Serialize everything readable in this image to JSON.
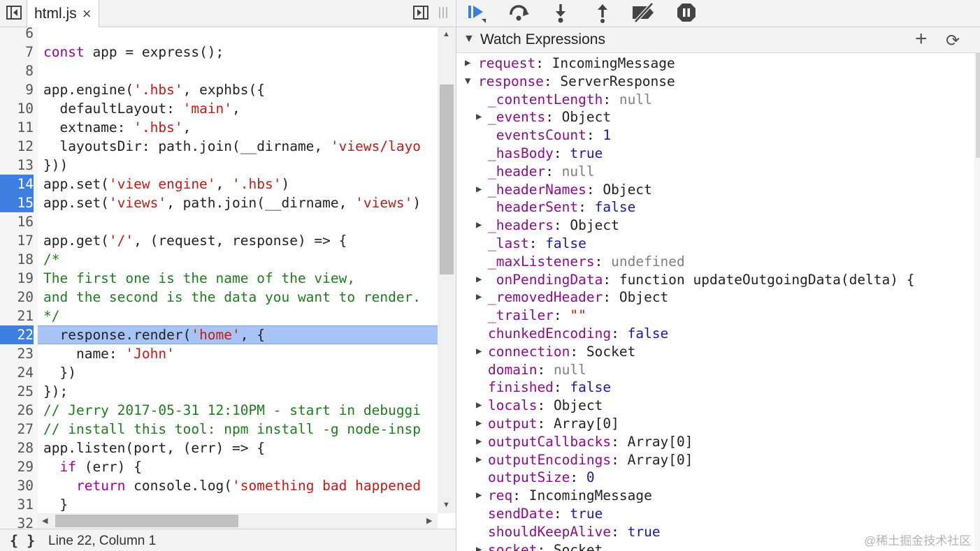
{
  "editor": {
    "tab_label": "html.js",
    "tab_close": "×",
    "lines": [
      {
        "n": "6",
        "parts": []
      },
      {
        "n": "7",
        "parts": [
          [
            "kw",
            "const"
          ],
          [
            "p",
            " app = express();"
          ]
        ]
      },
      {
        "n": "8",
        "parts": []
      },
      {
        "n": "9",
        "parts": [
          [
            "p",
            "app.engine("
          ],
          [
            "str",
            "'.hbs'"
          ],
          [
            "p",
            ", exphbs({"
          ]
        ]
      },
      {
        "n": "10",
        "parts": [
          [
            "p",
            "  defaultLayout: "
          ],
          [
            "str",
            "'main'"
          ],
          [
            "p",
            ","
          ]
        ]
      },
      {
        "n": "11",
        "parts": [
          [
            "p",
            "  extname: "
          ],
          [
            "str",
            "'.hbs'"
          ],
          [
            "p",
            ","
          ]
        ]
      },
      {
        "n": "12",
        "parts": [
          [
            "p",
            "  layoutsDir: path.join(__dirname, "
          ],
          [
            "str",
            "'views/layo"
          ]
        ]
      },
      {
        "n": "13",
        "parts": [
          [
            "p",
            "}))"
          ]
        ]
      },
      {
        "n": "14",
        "bp": true,
        "parts": [
          [
            "p",
            "app.set("
          ],
          [
            "str",
            "'view engine'"
          ],
          [
            "p",
            ", "
          ],
          [
            "str",
            "'.hbs'"
          ],
          [
            "p",
            ")"
          ]
        ]
      },
      {
        "n": "15",
        "bp": true,
        "parts": [
          [
            "p",
            "app.set("
          ],
          [
            "str",
            "'views'"
          ],
          [
            "p",
            ", path.join(__dirname, "
          ],
          [
            "str",
            "'views'"
          ],
          [
            "p",
            ")"
          ]
        ]
      },
      {
        "n": "16",
        "parts": []
      },
      {
        "n": "17",
        "parts": [
          [
            "p",
            "app.get("
          ],
          [
            "str",
            "'/'"
          ],
          [
            "p",
            ", (request, response) => {"
          ]
        ]
      },
      {
        "n": "18",
        "parts": [
          [
            "cm",
            "/*"
          ]
        ]
      },
      {
        "n": "19",
        "parts": [
          [
            "cm",
            "The first one is the name of the view,"
          ]
        ]
      },
      {
        "n": "20",
        "parts": [
          [
            "cm",
            "and the second is the data you want to render."
          ]
        ]
      },
      {
        "n": "21",
        "parts": [
          [
            "cm",
            "*/"
          ]
        ]
      },
      {
        "n": "22",
        "bp": true,
        "exec": true,
        "parts": [
          [
            "p",
            "  response.render("
          ],
          [
            "str",
            "'home'"
          ],
          [
            "p",
            ", {"
          ]
        ]
      },
      {
        "n": "23",
        "parts": [
          [
            "p",
            "    name: "
          ],
          [
            "str",
            "'John'"
          ]
        ]
      },
      {
        "n": "24",
        "parts": [
          [
            "p",
            "  })"
          ]
        ]
      },
      {
        "n": "25",
        "parts": [
          [
            "p",
            "});"
          ]
        ]
      },
      {
        "n": "26",
        "parts": [
          [
            "cm",
            "// Jerry 2017-05-31 12:10PM - start in debuggi"
          ]
        ]
      },
      {
        "n": "27",
        "parts": [
          [
            "cm",
            "// install this tool: npm install -g node-insp"
          ]
        ]
      },
      {
        "n": "28",
        "parts": [
          [
            "p",
            "app.listen(port, (err) => {"
          ]
        ]
      },
      {
        "n": "29",
        "parts": [
          [
            "p",
            "  "
          ],
          [
            "kw",
            "if"
          ],
          [
            "p",
            " (err) {"
          ]
        ]
      },
      {
        "n": "30",
        "parts": [
          [
            "p",
            "    "
          ],
          [
            "kw",
            "return"
          ],
          [
            "p",
            " console.log("
          ],
          [
            "str",
            "'something bad happened"
          ]
        ]
      },
      {
        "n": "31",
        "parts": [
          [
            "p",
            "  }"
          ]
        ]
      },
      {
        "n": "32",
        "parts": []
      }
    ],
    "status_icon": "{ }",
    "status_position": "Line 22, Column 1"
  },
  "debugger": {
    "toolbar_icons": [
      "resume-icon",
      "step-over-icon",
      "step-into-icon",
      "step-out-icon",
      "deactivate-breakpoints-icon",
      "pause-on-exceptions-icon"
    ],
    "watch_title": "Watch Expressions",
    "add_glyph": "+",
    "refresh_glyph": "⟳",
    "props": [
      {
        "d": 0,
        "e": "c",
        "name": "request",
        "sep": ": ",
        "val": "IncomingMessage",
        "t": "obj"
      },
      {
        "d": 0,
        "e": "o",
        "name": "response",
        "sep": ": ",
        "val": "ServerResponse",
        "t": "obj"
      },
      {
        "d": 1,
        "e": "",
        "name": "_contentLength",
        "sep": ": ",
        "val": "null",
        "t": "null"
      },
      {
        "d": 1,
        "e": "c",
        "name": "_events",
        "sep": ": ",
        "val": "Object",
        "t": "obj"
      },
      {
        "d": 1,
        "e": "",
        "name": " eventsCount",
        "sep": ": ",
        "val": "1",
        "t": "num"
      },
      {
        "d": 1,
        "e": "",
        "name": "_hasBody",
        "sep": ": ",
        "val": "true",
        "t": "bool"
      },
      {
        "d": 1,
        "e": "",
        "name": "_header",
        "sep": ": ",
        "val": "null",
        "t": "null"
      },
      {
        "d": 1,
        "e": "c",
        "name": "_headerNames",
        "sep": ": ",
        "val": "Object",
        "t": "obj"
      },
      {
        "d": 1,
        "e": "",
        "name": " headerSent",
        "sep": ": ",
        "val": "false",
        "t": "bool"
      },
      {
        "d": 1,
        "e": "c",
        "name": "_headers",
        "sep": ": ",
        "val": "Object",
        "t": "obj"
      },
      {
        "d": 1,
        "e": "",
        "name": "_last",
        "sep": ": ",
        "val": "false",
        "t": "bool"
      },
      {
        "d": 1,
        "e": "",
        "name": "_maxListeners",
        "sep": ": ",
        "val": "undefined",
        "t": "null"
      },
      {
        "d": 1,
        "e": "c",
        "name": " onPendingData",
        "sep": ": ",
        "val": "function updateOutgoingData(delta) {",
        "t": "obj"
      },
      {
        "d": 1,
        "e": "c",
        "name": "_removedHeader",
        "sep": ": ",
        "val": "Object",
        "t": "obj"
      },
      {
        "d": 1,
        "e": "",
        "name": "_trailer",
        "sep": ": ",
        "val": "\"\"",
        "t": "strv"
      },
      {
        "d": 1,
        "e": "",
        "name": "chunkedEncoding",
        "sep": ": ",
        "val": "false",
        "t": "bool"
      },
      {
        "d": 1,
        "e": "c",
        "name": "connection",
        "sep": ": ",
        "val": "Socket",
        "t": "obj"
      },
      {
        "d": 1,
        "e": "",
        "name": "domain",
        "sep": ": ",
        "val": "null",
        "t": "null"
      },
      {
        "d": 1,
        "e": "",
        "name": "finished",
        "sep": ": ",
        "val": "false",
        "t": "bool"
      },
      {
        "d": 1,
        "e": "c",
        "name": "locals",
        "sep": ": ",
        "val": "Object",
        "t": "obj"
      },
      {
        "d": 1,
        "e": "c",
        "name": "output",
        "sep": ": ",
        "val": "Array[0]",
        "t": "obj"
      },
      {
        "d": 1,
        "e": "c",
        "name": "outputCallbacks",
        "sep": ": ",
        "val": "Array[0]",
        "t": "obj"
      },
      {
        "d": 1,
        "e": "c",
        "name": "outputEncodings",
        "sep": ": ",
        "val": "Array[0]",
        "t": "obj"
      },
      {
        "d": 1,
        "e": "",
        "name": "outputSize",
        "sep": ": ",
        "val": "0",
        "t": "num"
      },
      {
        "d": 1,
        "e": "c",
        "name": "req",
        "sep": ": ",
        "val": "IncomingMessage",
        "t": "obj"
      },
      {
        "d": 1,
        "e": "",
        "name": "sendDate",
        "sep": ": ",
        "val": "true",
        "t": "bool"
      },
      {
        "d": 1,
        "e": "",
        "name": "shouldKeepAlive",
        "sep": ": ",
        "val": "true",
        "t": "bool"
      },
      {
        "d": 1,
        "e": "c",
        "name": "socket",
        "sep": ": ",
        "val": "Socket",
        "t": "obj"
      }
    ]
  },
  "watermark": "@稀土掘金技术社区",
  "colors": {
    "breakpoint": "#3c7fe0",
    "exec_line": "#a6c4f5",
    "resume": "#3c7fe0"
  }
}
